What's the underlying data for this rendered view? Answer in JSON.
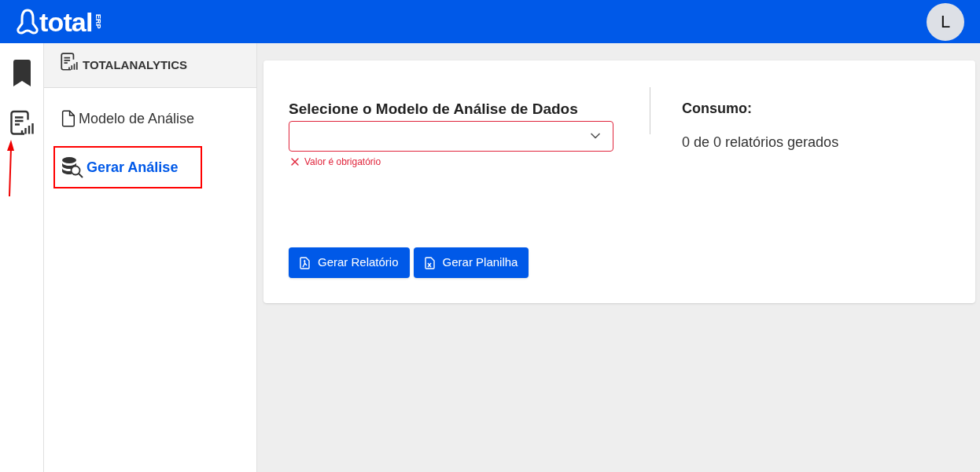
{
  "header": {
    "logo": "total",
    "logo_suffix": "ERP",
    "avatar": "L"
  },
  "rail": [
    {
      "kind": "bookmark"
    },
    {
      "kind": "analytics"
    }
  ],
  "sidebar": {
    "title": "TOTALANALYTICS",
    "items": [
      {
        "label": "Modelo de Análise",
        "kind": "document",
        "selected": false
      },
      {
        "label": "Gerar Análise",
        "kind": "database",
        "selected": true
      }
    ]
  },
  "form": {
    "label": "Selecione o Modelo de Análise de Dados",
    "error": "Valor é obrigatório",
    "invalid": true
  },
  "consumo": {
    "title": "Consumo:",
    "text": "0 de 0 relatórios gerados"
  },
  "buttons": [
    {
      "label": "Gerar Relatório",
      "kind": "pdf"
    },
    {
      "label": "Gerar Planilha",
      "kind": "excel"
    }
  ]
}
